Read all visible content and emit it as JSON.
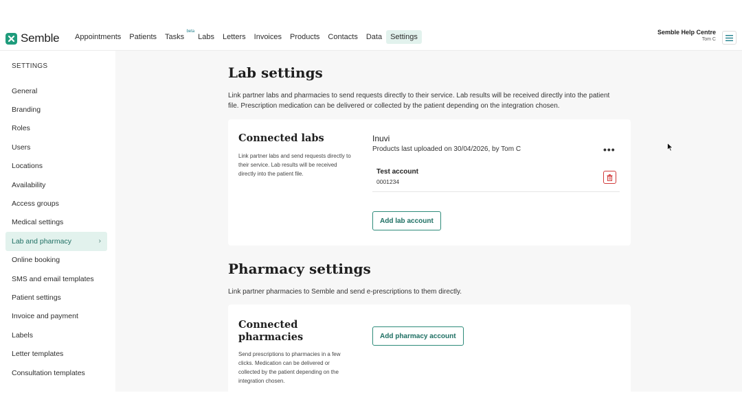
{
  "nav": {
    "logo_text": "Semble",
    "links": [
      {
        "label": "Appointments"
      },
      {
        "label": "Patients"
      },
      {
        "label": "Tasks",
        "badge": "beta"
      },
      {
        "label": "Labs"
      },
      {
        "label": "Letters"
      },
      {
        "label": "Invoices"
      },
      {
        "label": "Products"
      },
      {
        "label": "Contacts"
      },
      {
        "label": "Data"
      },
      {
        "label": "Settings",
        "active": true
      }
    ],
    "help_title": "Semble Help Centre",
    "user_name": "Tom C"
  },
  "sidebar": {
    "title": "SETTINGS",
    "items": [
      {
        "label": "General"
      },
      {
        "label": "Branding"
      },
      {
        "label": "Roles"
      },
      {
        "label": "Users"
      },
      {
        "label": "Locations"
      },
      {
        "label": "Availability"
      },
      {
        "label": "Access groups"
      },
      {
        "label": "Medical settings"
      },
      {
        "label": "Lab and pharmacy",
        "active": true
      },
      {
        "label": "Online booking"
      },
      {
        "label": "SMS and email templates"
      },
      {
        "label": "Patient settings"
      },
      {
        "label": "Invoice and payment"
      },
      {
        "label": "Labels"
      },
      {
        "label": "Letter templates"
      },
      {
        "label": "Consultation templates"
      }
    ],
    "active_chevron": "›"
  },
  "lab_settings": {
    "title": "Lab settings",
    "description": "Link partner labs and pharmacies to send requests directly to their service. Lab results will be received directly into the patient file. Prescription medication can be delivered or collected by the patient depending on the integration chosen.",
    "card": {
      "title": "Connected labs",
      "description": "Link partner labs and send requests directly to their service. Lab results will be received directly into the patient file.",
      "lab_name": "Inuvi",
      "lab_meta": "Products last uploaded on 30/04/2026, by Tom C",
      "more_label": "•••",
      "account_name": "Test account",
      "account_number": "0001234",
      "add_button": "Add lab account"
    }
  },
  "pharmacy_settings": {
    "title": "Pharmacy settings",
    "description": "Link partner pharmacies to Semble and send e-prescriptions to them directly.",
    "card": {
      "title_line1": "Connected",
      "title_line2": "pharmacies",
      "description": "Send prescriptions to pharmacies in a few clicks. Medication can be delivered or collected by the patient depending on the integration chosen.",
      "add_button": "Add pharmacy account"
    }
  },
  "colors": {
    "brand": "#1f9c7c",
    "active_bg": "#e2f2ed",
    "danger": "#d13a3a"
  }
}
